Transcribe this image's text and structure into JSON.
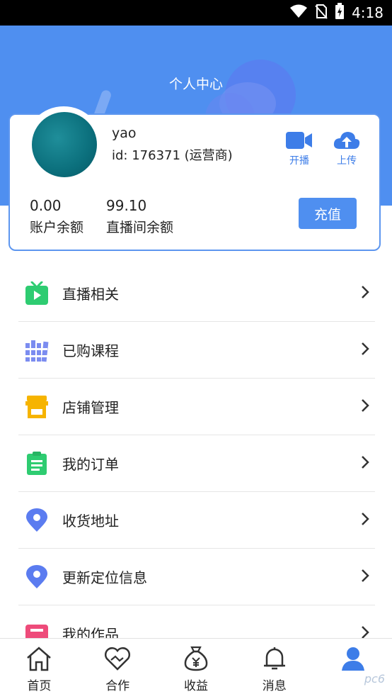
{
  "status_bar": {
    "time": "4:18",
    "icons": [
      "wifi-icon",
      "no-sim-icon",
      "battery-charging-icon"
    ]
  },
  "header": {
    "title": "个人中心"
  },
  "profile": {
    "username": "yao",
    "id_text": "id: 176371 (运营商)",
    "actions": [
      {
        "label": "开播",
        "icon": "video-camera-icon"
      },
      {
        "label": "上传",
        "icon": "cloud-upload-icon"
      }
    ],
    "balances": [
      {
        "value": "0.00",
        "label": "账户余额"
      },
      {
        "value": "99.10",
        "label": "直播间余额"
      }
    ],
    "recharge_label": "充值"
  },
  "menu": {
    "items": [
      {
        "label": "直播相关",
        "icon": "tv-play-icon"
      },
      {
        "label": "已购课程",
        "icon": "books-icon"
      },
      {
        "label": "店铺管理",
        "icon": "shop-icon"
      },
      {
        "label": "我的订单",
        "icon": "clipboard-icon"
      },
      {
        "label": "收货地址",
        "icon": "location-pin-icon"
      },
      {
        "label": "更新定位信息",
        "icon": "location-pin-icon"
      },
      {
        "label": "我的作品",
        "icon": "works-icon"
      }
    ]
  },
  "bottom_nav": {
    "items": [
      {
        "label": "首页",
        "icon": "home-icon"
      },
      {
        "label": "合作",
        "icon": "handshake-heart-icon"
      },
      {
        "label": "收益",
        "icon": "money-bag-icon"
      },
      {
        "label": "消息",
        "icon": "bell-icon"
      },
      {
        "label": "",
        "icon": "user-icon",
        "active": true
      }
    ]
  },
  "colors": {
    "accent": "#4f8ff0",
    "link": "#3d7de8",
    "green": "#2ecc71",
    "yellow": "#f6b400",
    "blue_purple": "#5b7cf0",
    "pink": "#ee4b7a"
  },
  "watermark": "pc6"
}
